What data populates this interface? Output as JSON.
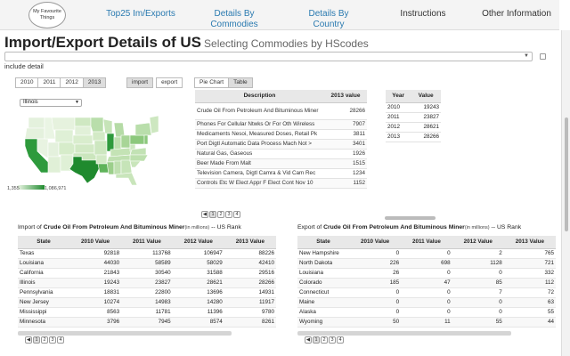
{
  "nav": {
    "logo_text": "My Favourite Things",
    "items": [
      "Top25 Im/Exports",
      "Details By Commodies",
      "Details By Country",
      "Instructions",
      "Other Information"
    ]
  },
  "title": "Import/Export Details of US",
  "subtitle": "Selecting Commodies by HScodes",
  "include_detail": "include detail",
  "years": [
    "2010",
    "2011",
    "2012",
    "2013"
  ],
  "flow": [
    "import",
    "export"
  ],
  "view_tabs": [
    "Pie Chart",
    "Table"
  ],
  "state_select": "Illinois",
  "legend": {
    "min": "1,355",
    "max": "1,086,971"
  },
  "commodity_table": {
    "headers": [
      "Description",
      "2013 value"
    ],
    "rows": [
      [
        "Crude Oil From Petroleum And Bituminous Miner",
        "28266"
      ],
      [
        "Phones For Cellular Ntwks Or For Oth Wireless",
        "7907"
      ],
      [
        "Medicaments Nesoi, Measured Doses, Retail Pk",
        "3811"
      ],
      [
        "Port Digtl Automatic Data Process Mach Not >",
        "3401"
      ],
      [
        "Natural Gas, Gaseous",
        "1926"
      ],
      [
        "Beer Made From Malt",
        "1515"
      ],
      [
        "Television Camera, Digtl Camra & Vid Cam Rec",
        "1234"
      ],
      [
        "Controls Etc W Elect Appr F Elect Cont Nov 10",
        "1152"
      ]
    ]
  },
  "year_table": {
    "headers": [
      "Year",
      "Value"
    ],
    "rows": [
      [
        "2010",
        "19243"
      ],
      [
        "2011",
        "23827"
      ],
      [
        "2012",
        "28621"
      ],
      [
        "2013",
        "28266"
      ]
    ]
  },
  "pager_pages": [
    "1",
    "2",
    "3",
    "4"
  ],
  "import_title": {
    "prefix": "Import of ",
    "commodity": "Crude Oil From Petroleum And Bituminous Miner",
    "units": "(in millions)",
    "suffix": " -- US Rank"
  },
  "export_title": {
    "prefix": "Export of ",
    "commodity": "Crude Oil From Petroleum And Bituminous Miner",
    "units": "(in millions)",
    "suffix": " -- US Rank"
  },
  "rank_headers": [
    "State",
    "2010 Value",
    "2011 Value",
    "2012 Value",
    "2013 Value"
  ],
  "import_rows": [
    [
      "Texas",
      "92818",
      "113768",
      "106947",
      "88226"
    ],
    [
      "Louisiana",
      "44030",
      "58589",
      "58029",
      "42410"
    ],
    [
      "California",
      "21843",
      "30540",
      "31588",
      "29516"
    ],
    [
      "Illinois",
      "19243",
      "23827",
      "28621",
      "28266"
    ],
    [
      "Pennsylvania",
      "18831",
      "22800",
      "13696",
      "14931"
    ],
    [
      "New Jersey",
      "10274",
      "14983",
      "14280",
      "11917"
    ],
    [
      "Mississippi",
      "8563",
      "11781",
      "11396",
      "9780"
    ],
    [
      "Minnesota",
      "3796",
      "7945",
      "8574",
      "8261"
    ]
  ],
  "export_rows": [
    [
      "New Hampshire",
      "0",
      "0",
      "2",
      "765"
    ],
    [
      "North Dakota",
      "226",
      "698",
      "1128",
      "721"
    ],
    [
      "Louisiana",
      "26",
      "0",
      "0",
      "332"
    ],
    [
      "Colorado",
      "185",
      "47",
      "85",
      "112"
    ],
    [
      "Connecticut",
      "0",
      "0",
      "7",
      "72"
    ],
    [
      "Maine",
      "0",
      "0",
      "0",
      "63"
    ],
    [
      "Alaska",
      "0",
      "0",
      "0",
      "55"
    ],
    [
      "Wyoming",
      "50",
      "11",
      "55",
      "44"
    ]
  ],
  "colors": {
    "nav_link": "#2a7ab0",
    "map_high": "#1f8a2e",
    "map_low": "#eaf5e4"
  }
}
